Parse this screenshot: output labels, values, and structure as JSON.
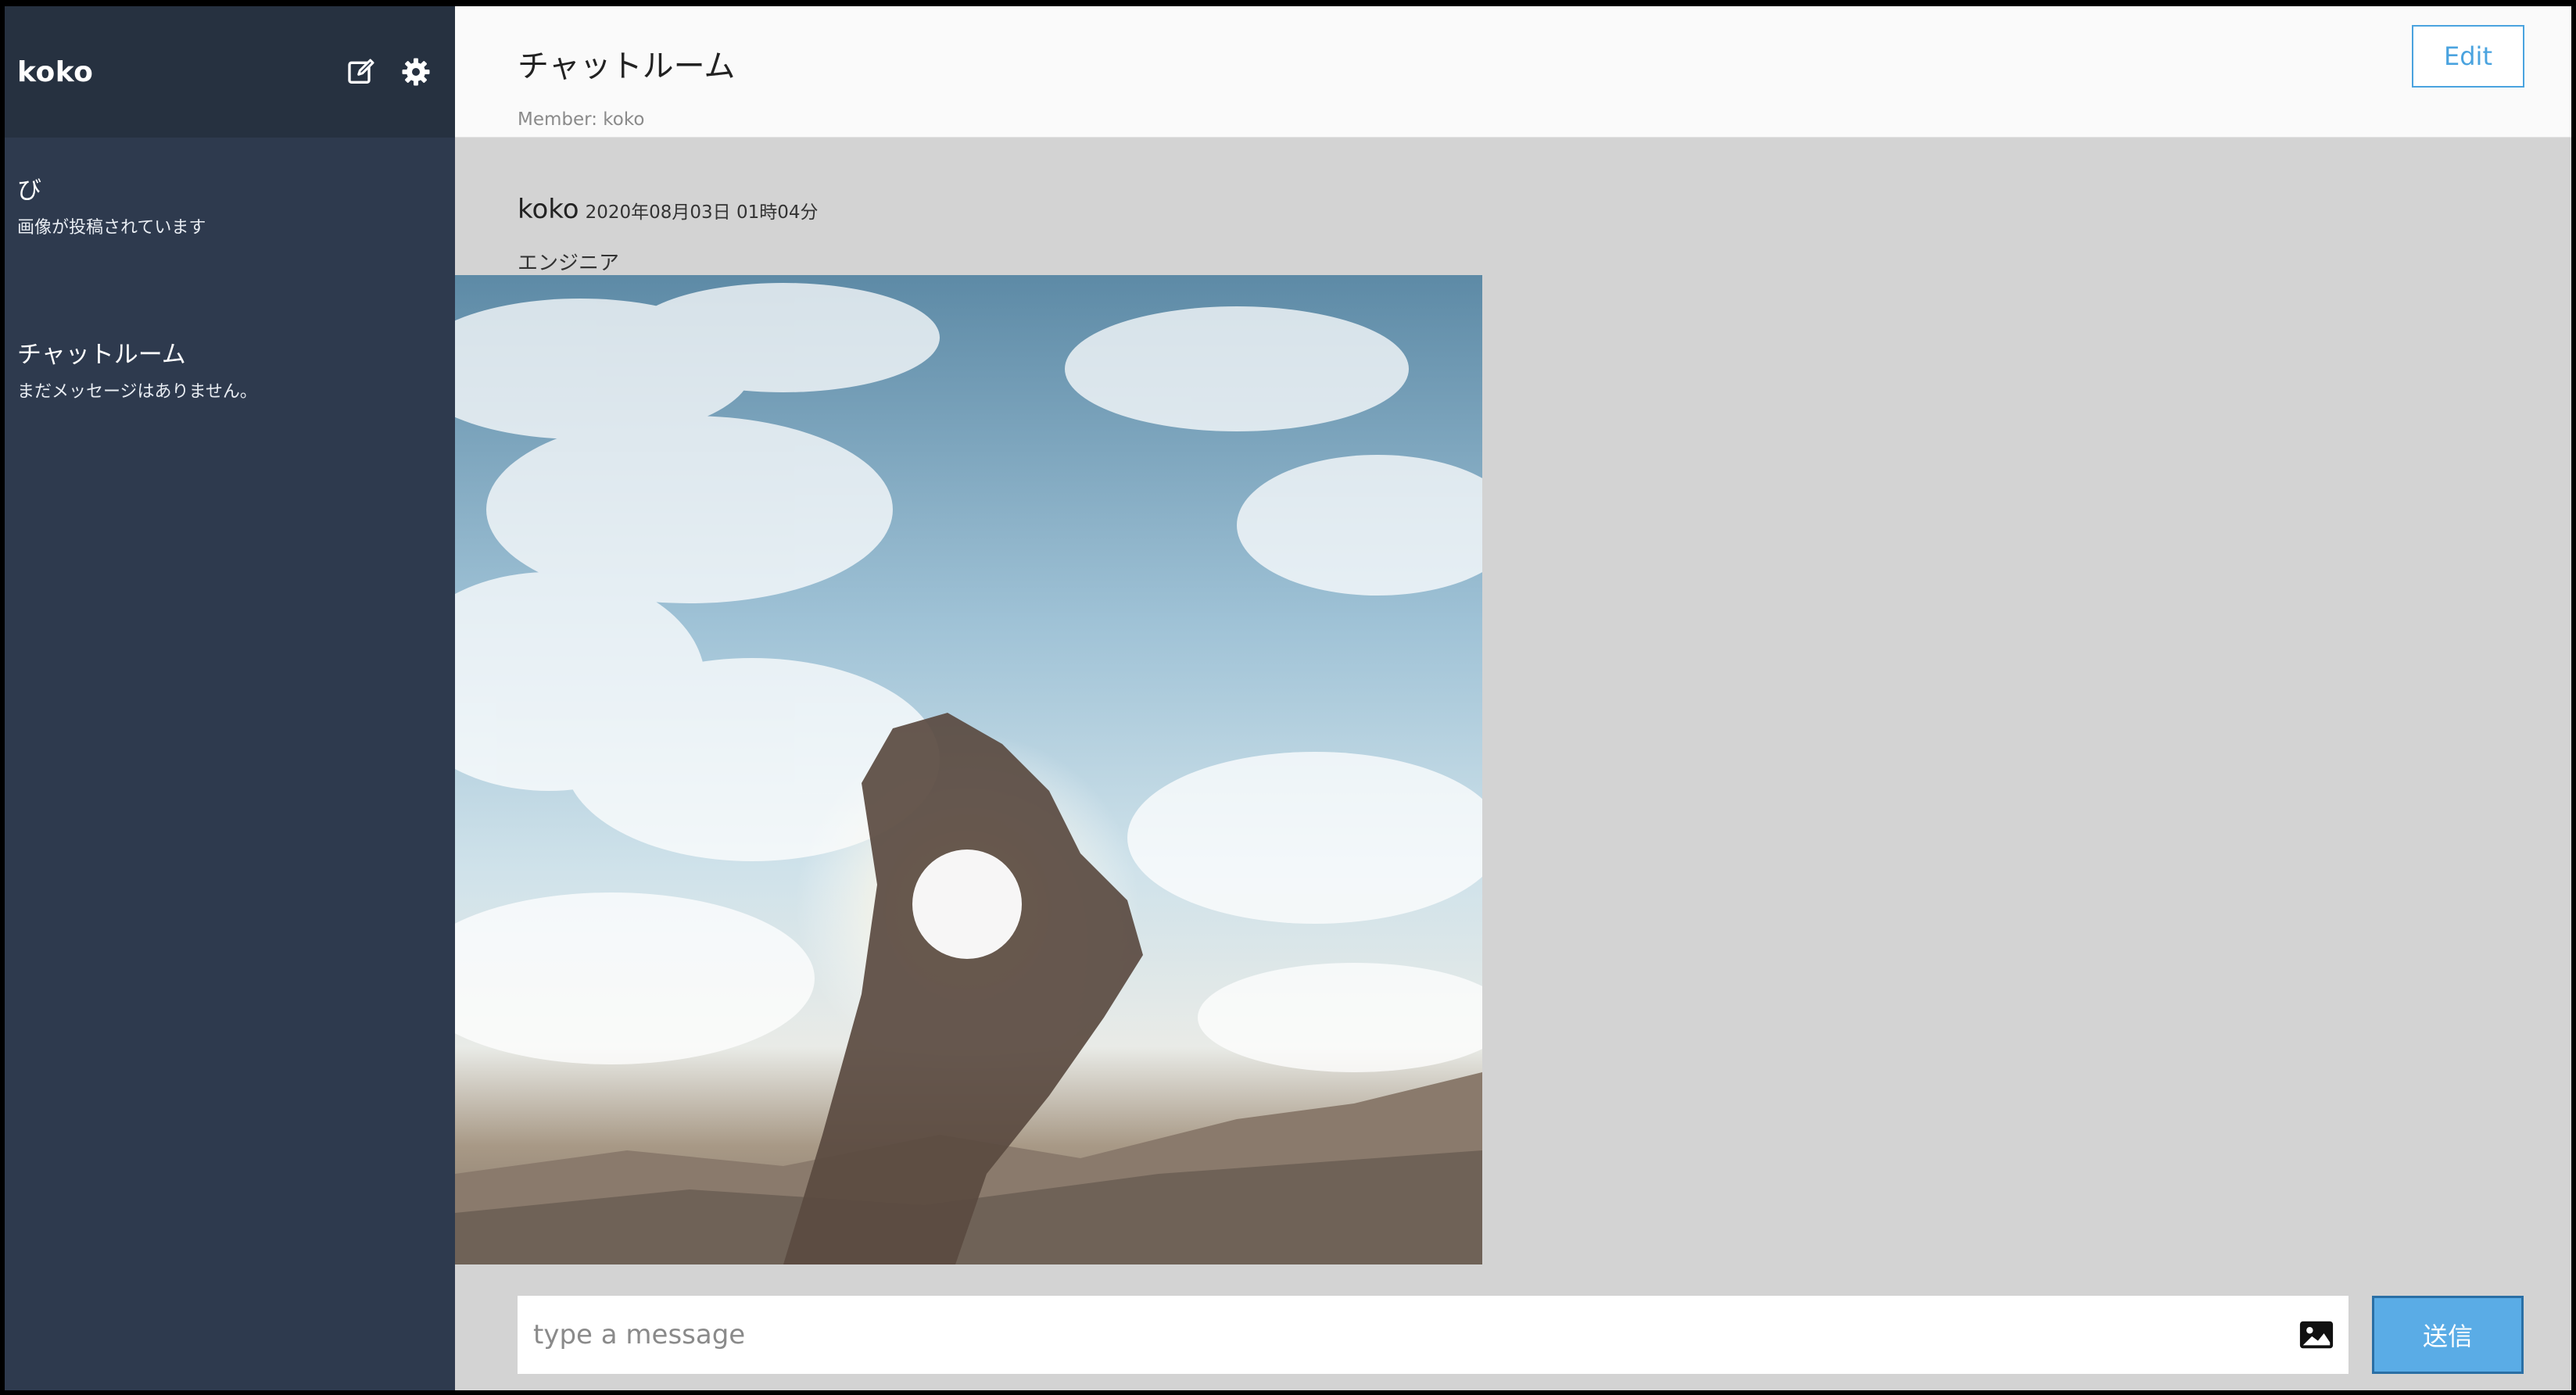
{
  "sidebar": {
    "user_name": "koko",
    "icons": {
      "compose": "edit-square-icon",
      "settings": "gear-icon"
    },
    "rooms": [
      {
        "name": "び",
        "preview": "画像が投稿されています"
      },
      {
        "name": "チャットルーム",
        "preview": "まだメッセージはありません。"
      }
    ]
  },
  "header": {
    "title": "チャットルーム",
    "members": "Member: koko",
    "edit_label": "Edit"
  },
  "messages": [
    {
      "author": "koko",
      "time": "2020年08月03日 01時04分",
      "text": "エンジニア",
      "image": "photo of a hand forming a ring around the sun against a cloudy sky over mountains"
    }
  ],
  "composer": {
    "placeholder": "type a message",
    "image_icon": "image-icon",
    "send_label": "送信"
  },
  "colors": {
    "sidebar_bg": "#2e3a4e",
    "sidebar_header_bg": "#263140",
    "chat_bg": "#d3d3d3",
    "accent": "#4aa3df",
    "send_bg": "#5aace6"
  }
}
